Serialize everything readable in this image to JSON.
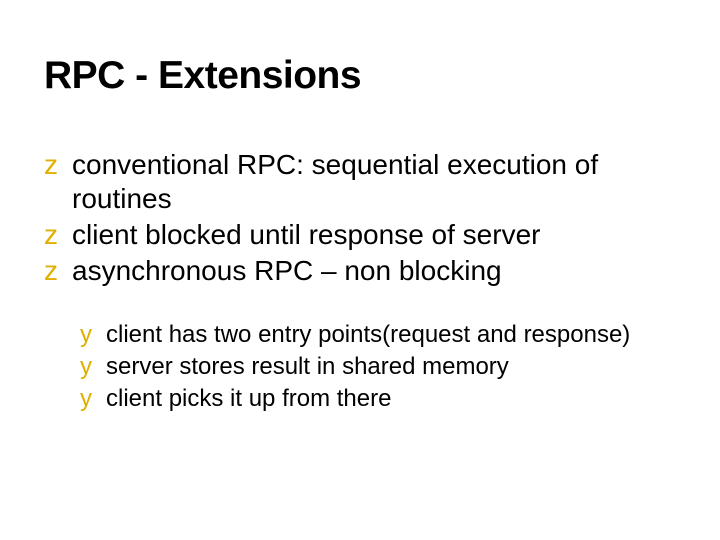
{
  "title": "RPC - Extensions",
  "bullets": {
    "level1": [
      {
        "marker": "z",
        "text": "conventional RPC: sequential execution of routines"
      },
      {
        "marker": "z",
        "text": "client blocked until response of server"
      },
      {
        "marker": "z",
        "text": "asynchronous RPC – non blocking"
      }
    ],
    "level2": [
      {
        "marker": "y",
        "text": "client has two entry points(request and response)"
      },
      {
        "marker": "y",
        "text": "server stores result in shared memory"
      },
      {
        "marker": "y",
        "text": "client picks it up from there"
      }
    ]
  }
}
